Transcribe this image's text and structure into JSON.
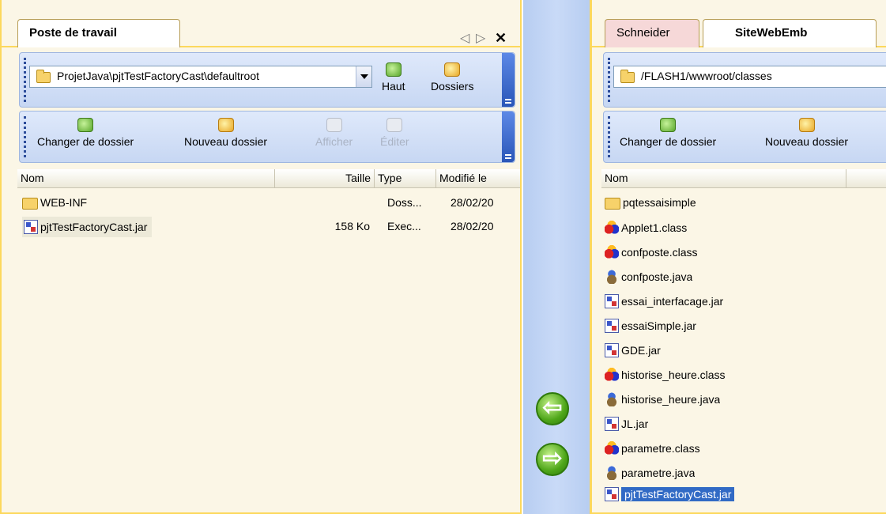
{
  "left": {
    "tab": "Poste de travail",
    "tab_controls": {
      "prev": "◁",
      "next": "▷",
      "close": "✕"
    },
    "path": "ProjetJava\\pjtTestFactoryCast\\defaultroot",
    "toolbar1": {
      "up": "Haut",
      "folders": "Dossiers"
    },
    "toolbar2": {
      "change_dir": "Changer de dossier",
      "new_dir": "Nouveau dossier",
      "view": "Afficher",
      "edit": "Éditer"
    },
    "columns": {
      "name": "Nom",
      "size": "Taille",
      "type": "Type",
      "modified": "Modifié le"
    },
    "files": [
      {
        "name": "WEB-INF",
        "size": "",
        "type": "Doss...",
        "modified": "28/02/20",
        "icon": "folder"
      },
      {
        "name": "pjtTestFactoryCast.jar",
        "size": "158 Ko",
        "type": "Exec...",
        "modified": "28/02/20",
        "icon": "jar"
      }
    ]
  },
  "right": {
    "tabs": [
      "Schneider",
      "SiteWebEmb"
    ],
    "path": "/FLASH1/wwwroot/classes",
    "toolbar2": {
      "change_dir": "Changer de dossier",
      "new_dir": "Nouveau dossier"
    },
    "columns": {
      "name": "Nom"
    },
    "files": [
      {
        "name": "pqtessaisimple",
        "icon": "folder"
      },
      {
        "name": "Applet1.class",
        "icon": "class"
      },
      {
        "name": "confposte.class",
        "icon": "class"
      },
      {
        "name": "confposte.java",
        "icon": "java"
      },
      {
        "name": "essai_interfacage.jar",
        "icon": "jar"
      },
      {
        "name": "essaiSimple.jar",
        "icon": "jar"
      },
      {
        "name": "GDE.jar",
        "icon": "jar"
      },
      {
        "name": "historise_heure.class",
        "icon": "class"
      },
      {
        "name": "historise_heure.java",
        "icon": "java"
      },
      {
        "name": "JL.jar",
        "icon": "jar"
      },
      {
        "name": "parametre.class",
        "icon": "class"
      },
      {
        "name": "parametre.java",
        "icon": "java"
      },
      {
        "name": "pjtTestFactoryCast.jar",
        "icon": "jar"
      }
    ]
  },
  "transfer": {
    "left_arrow": "⇦",
    "right_arrow": "⇨"
  },
  "colors": {
    "accent": "#fcd85d",
    "toolbar": "#c7d7f3",
    "selection": "#316ac5",
    "transfer": "#4ea619"
  }
}
